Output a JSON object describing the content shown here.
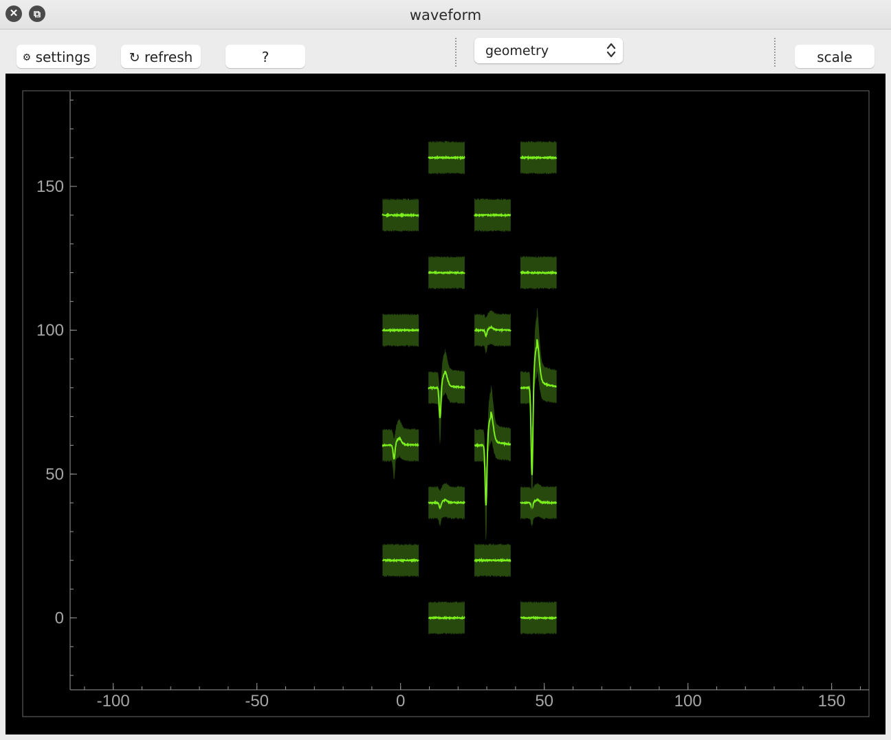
{
  "window": {
    "title": "waveform",
    "close_glyph": "✕",
    "restore_glyph": "⧉"
  },
  "toolbar": {
    "settings_icon": "⚙",
    "settings_label": "settings",
    "refresh_icon": "↻",
    "refresh_label": "refresh",
    "help_label": "?",
    "view_select": {
      "value": "geometry",
      "arrows": "⌃⌄"
    },
    "scale_label": "scale"
  },
  "colors": {
    "trace": "#7cf01c",
    "band": "#27490e",
    "plot_background": "#000000",
    "axis": "#9a9a9a",
    "tick_label": "#a6a6a6"
  },
  "chart_data": {
    "type": "scatter",
    "title": "",
    "xlabel": "",
    "ylabel": "",
    "xlim": [
      -115,
      163
    ],
    "ylim": [
      -25,
      183
    ],
    "xticks": [
      -100,
      -50,
      0,
      50,
      100,
      150
    ],
    "yticks": [
      0,
      50,
      100,
      150
    ],
    "x_tick_labels": [
      "-100",
      "-50",
      "0",
      "50",
      "100",
      "150"
    ],
    "y_tick_labels": [
      "0",
      "50",
      "100",
      "150"
    ],
    "grid": false,
    "legend": "none",
    "channels": [
      {
        "x": 16,
        "y": 0,
        "spike": 0
      },
      {
        "x": 48,
        "y": 0,
        "spike": 0
      },
      {
        "x": 0,
        "y": 20,
        "spike": 0
      },
      {
        "x": 32,
        "y": 20,
        "spike": 0
      },
      {
        "x": 16,
        "y": 40,
        "spike": 2
      },
      {
        "x": 48,
        "y": 40,
        "spike": 2
      },
      {
        "x": 0,
        "y": 60,
        "spike": 5
      },
      {
        "x": 32,
        "y": 60,
        "spike": 22
      },
      {
        "x": 16,
        "y": 80,
        "spike": 11
      },
      {
        "x": 48,
        "y": 80,
        "spike": 32
      },
      {
        "x": 0,
        "y": 100,
        "spike": 0
      },
      {
        "x": 32,
        "y": 100,
        "spike": 2
      },
      {
        "x": 16,
        "y": 120,
        "spike": 0
      },
      {
        "x": 48,
        "y": 120,
        "spike": 0
      },
      {
        "x": 0,
        "y": 140,
        "spike": 0
      },
      {
        "x": 32,
        "y": 140,
        "spike": 0
      },
      {
        "x": 16,
        "y": 160,
        "spike": 0
      },
      {
        "x": 48,
        "y": 160,
        "spike": 0
      }
    ]
  }
}
